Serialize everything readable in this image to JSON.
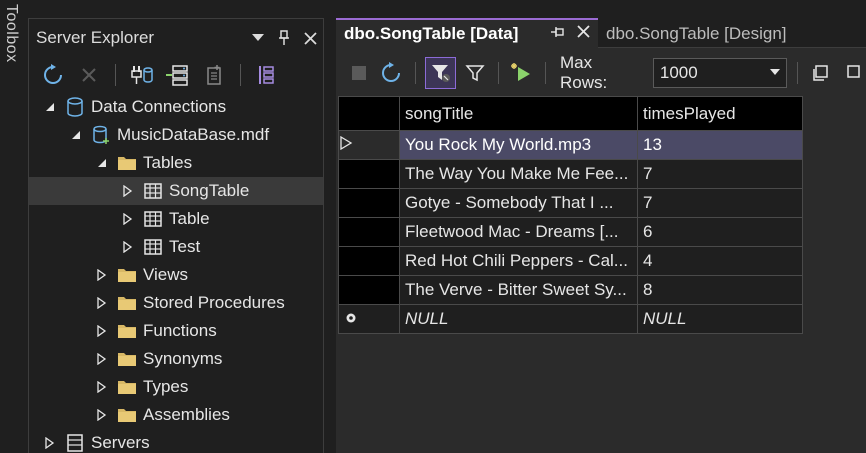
{
  "toolbox": {
    "label": "Toolbox"
  },
  "server_explorer": {
    "title": "Server Explorer",
    "title_buttons": {
      "dropdown": "▾",
      "pin": "📌",
      "close": "✕"
    },
    "tree": [
      {
        "label": "Data Connections",
        "level": 0,
        "expanded": true,
        "icon": "database-icon"
      },
      {
        "label": "MusicDataBase.mdf",
        "level": 1,
        "expanded": true,
        "icon": "database-file-icon"
      },
      {
        "label": "Tables",
        "level": 2,
        "expanded": true,
        "icon": "folder-icon"
      },
      {
        "label": "SongTable",
        "level": 3,
        "expanded": false,
        "icon": "table-icon",
        "selected": true
      },
      {
        "label": "Table",
        "level": 3,
        "expanded": false,
        "icon": "table-icon"
      },
      {
        "label": "Test",
        "level": 3,
        "expanded": false,
        "icon": "table-icon"
      },
      {
        "label": "Views",
        "level": 2,
        "expanded": false,
        "icon": "folder-icon"
      },
      {
        "label": "Stored Procedures",
        "level": 2,
        "expanded": false,
        "icon": "folder-icon"
      },
      {
        "label": "Functions",
        "level": 2,
        "expanded": false,
        "icon": "folder-icon"
      },
      {
        "label": "Synonyms",
        "level": 2,
        "expanded": false,
        "icon": "folder-icon"
      },
      {
        "label": "Types",
        "level": 2,
        "expanded": false,
        "icon": "folder-icon"
      },
      {
        "label": "Assemblies",
        "level": 2,
        "expanded": false,
        "icon": "folder-icon"
      },
      {
        "label": "Servers",
        "level": 0,
        "expanded": false,
        "icon": "server-icon"
      }
    ]
  },
  "editor": {
    "tabs": [
      {
        "label": "dbo.SongTable [Data]",
        "active": true
      },
      {
        "label": "dbo.SongTable [Design]",
        "active": false
      }
    ],
    "toolbar": {
      "max_rows_label": "Max Rows:",
      "max_rows_value": "1000"
    },
    "grid": {
      "columns": [
        "songTitle",
        "timesPlayed"
      ],
      "rows": [
        {
          "songTitle": "You Rock My World.mp3",
          "timesPlayed": "13"
        },
        {
          "songTitle": "The Way You Make Me Fee...",
          "timesPlayed": "7"
        },
        {
          "songTitle": "Gotye - Somebody That I ...",
          "timesPlayed": "7"
        },
        {
          "songTitle": "Fleetwood Mac - Dreams [...",
          "timesPlayed": "6"
        },
        {
          "songTitle": "Red Hot Chili Peppers - Cal...",
          "timesPlayed": "4"
        },
        {
          "songTitle": "The Verve - Bitter Sweet Sy...",
          "timesPlayed": "8"
        }
      ],
      "new_row": {
        "songTitle": "NULL",
        "timesPlayed": "NULL"
      }
    }
  },
  "colors": {
    "accent": "#9b6bd3",
    "selection": "#4b4a66",
    "folder": "#d8b865",
    "icon_blue": "#6fb3e8"
  }
}
